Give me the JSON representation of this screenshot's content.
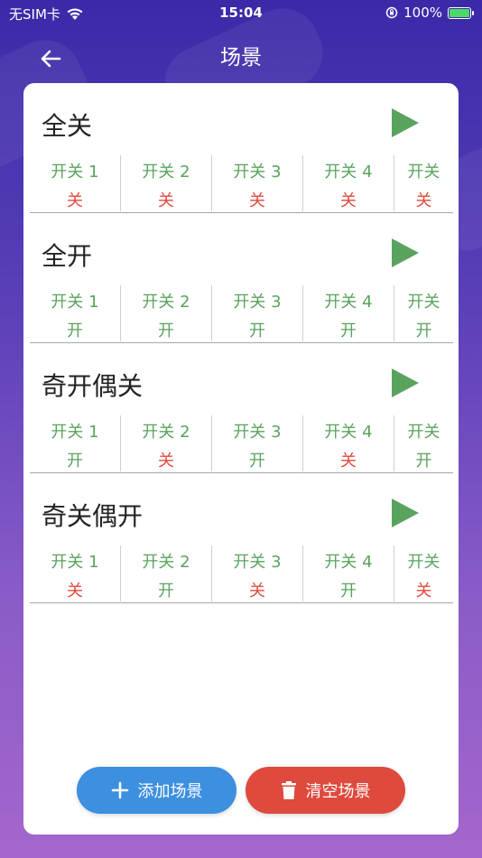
{
  "status_bar": {
    "carrier": "无SIM卡",
    "time": "15:04",
    "battery_percent": "100%"
  },
  "header": {
    "title": "场景"
  },
  "colors": {
    "on": "#5aa35e",
    "off": "#e04a3c",
    "add_button": "#3d8fe0",
    "clear_button": "#de4a3d"
  },
  "scenes": [
    {
      "title": "全关",
      "switches": [
        {
          "name": "开关 1",
          "state": "关",
          "on": false
        },
        {
          "name": "开关 2",
          "state": "关",
          "on": false
        },
        {
          "name": "开关 3",
          "state": "关",
          "on": false
        },
        {
          "name": "开关 4",
          "state": "关",
          "on": false
        },
        {
          "name": "开关",
          "state": "关",
          "on": false
        }
      ]
    },
    {
      "title": "全开",
      "switches": [
        {
          "name": "开关 1",
          "state": "开",
          "on": true
        },
        {
          "name": "开关 2",
          "state": "开",
          "on": true
        },
        {
          "name": "开关 3",
          "state": "开",
          "on": true
        },
        {
          "name": "开关 4",
          "state": "开",
          "on": true
        },
        {
          "name": "开关",
          "state": "开",
          "on": true
        }
      ]
    },
    {
      "title": "奇开偶关",
      "switches": [
        {
          "name": "开关 1",
          "state": "开",
          "on": true
        },
        {
          "name": "开关 2",
          "state": "关",
          "on": false
        },
        {
          "name": "开关 3",
          "state": "开",
          "on": true
        },
        {
          "name": "开关 4",
          "state": "关",
          "on": false
        },
        {
          "name": "开关",
          "state": "开",
          "on": true
        }
      ]
    },
    {
      "title": "奇关偶开",
      "switches": [
        {
          "name": "开关 1",
          "state": "关",
          "on": false
        },
        {
          "name": "开关 2",
          "state": "开",
          "on": true
        },
        {
          "name": "开关 3",
          "state": "关",
          "on": false
        },
        {
          "name": "开关 4",
          "state": "开",
          "on": true
        },
        {
          "name": "开关",
          "state": "关",
          "on": false
        }
      ]
    }
  ],
  "actions": {
    "add_label": "添加场景",
    "clear_label": "清空场景"
  }
}
